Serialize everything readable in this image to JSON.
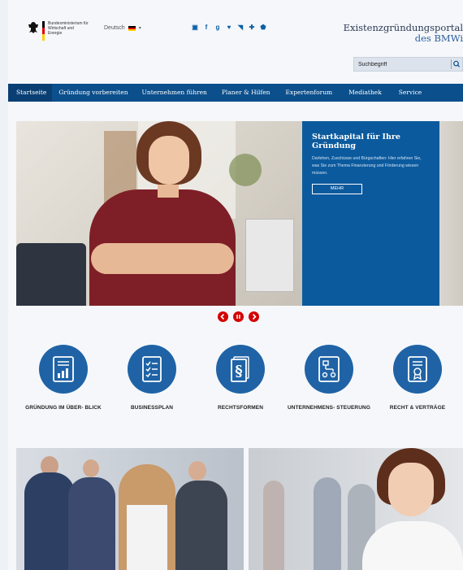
{
  "header": {
    "logo_text": "Bundesministerium für Wirtschaft und Energie",
    "language": "Deutsch",
    "portal_title_line1": "Existenzgründungsportal",
    "portal_title_line2": "des BMWi",
    "search_placeholder": "Suchbegriff",
    "socials": [
      "youtube-icon",
      "facebook-icon",
      "googleplus-icon",
      "twitter-icon",
      "rss-icon",
      "share-icon",
      "shield-icon"
    ]
  },
  "nav": {
    "items": [
      "Startseite",
      "Gründung vorbereiten",
      "Unternehmen führen",
      "Planer & Hilfen",
      "Expertenforum",
      "Mediathek",
      "Service"
    ]
  },
  "hero": {
    "title": "Startkapital für Ihre Gründung",
    "text": "Darlehen, Zuschüsse und Bürgschaften: Hier erfahren Sie, was Sie zum Thema Finanzierung und Förderung wissen müssen.",
    "button": "MEHR"
  },
  "categories": [
    {
      "label": "GRÜNDUNG IM ÜBER- BLICK",
      "icon": "document-chart-icon"
    },
    {
      "label": "BUSINESSPLAN",
      "icon": "checklist-icon"
    },
    {
      "label": "RECHTSFORMEN",
      "icon": "paragraph-icon"
    },
    {
      "label": "UNTERNEHMENS- STEUERUNG",
      "icon": "workflow-icon"
    },
    {
      "label": "RECHT & VERTRÄGE",
      "icon": "certificate-icon"
    }
  ],
  "colors": {
    "primary": "#0b4f8c",
    "accent": "#d40000",
    "icon_circle": "#1f63a6"
  }
}
